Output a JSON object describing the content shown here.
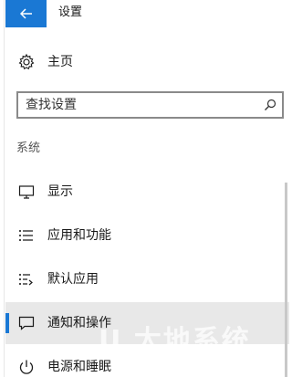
{
  "titlebar": {
    "back_icon": "back-arrow-icon",
    "title": "设置",
    "accent": "#1a78d4"
  },
  "home": {
    "icon": "gear-icon",
    "label": "主页"
  },
  "search": {
    "placeholder": "查找设置",
    "value": "",
    "icon": "search-icon"
  },
  "section": {
    "label": "系统"
  },
  "nav_items": [
    {
      "label": "显示",
      "icon": "display-icon",
      "selected": false
    },
    {
      "label": "应用和功能",
      "icon": "apps-list-icon",
      "selected": false
    },
    {
      "label": "默认应用",
      "icon": "default-apps-icon",
      "selected": false
    },
    {
      "label": "通知和操作",
      "icon": "notification-icon",
      "selected": true
    },
    {
      "label": "电源和睡眠",
      "icon": "power-icon",
      "selected": false
    }
  ],
  "colors": {
    "accent": "#1a78d4",
    "selected_bg": "#e8e8e8"
  }
}
